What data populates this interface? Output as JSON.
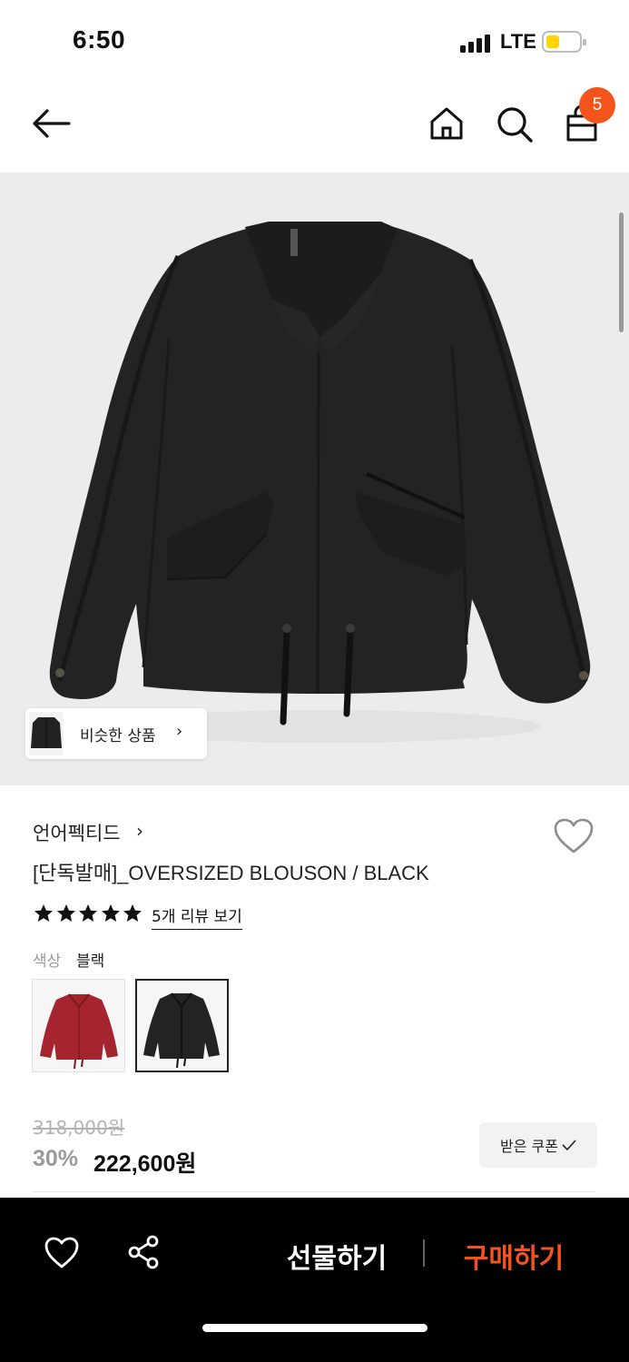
{
  "status_bar": {
    "time": "6:50",
    "network": "LTE"
  },
  "header": {
    "cart_count": "5"
  },
  "image": {
    "similar_label": "비슷한 상품"
  },
  "product": {
    "brand": "언어펙티드",
    "title": "[단독발매]_OVERSIZED BLOUSON / BLACK",
    "rating_stars": 5,
    "review_link": "5개 리뷰 보기",
    "color_label": "색상",
    "color_value": "블랙",
    "original_price": "318,000원",
    "discount": "30%",
    "final_price": "222,600원",
    "coupon_label": "받은 쿠폰"
  },
  "bottom_bar": {
    "gift_label": "선물하기",
    "buy_label": "구매하기"
  },
  "colors": {
    "accent": "#f2541c",
    "battery": "#ffd500",
    "swatch_red": "#a5242f"
  }
}
